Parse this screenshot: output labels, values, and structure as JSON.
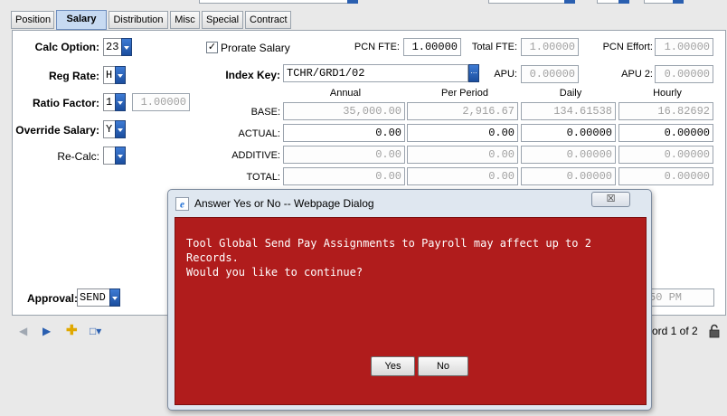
{
  "window": {
    "title": "Answer Yes or No -- Webpage Dialog"
  },
  "tabs": [
    "Position",
    "Salary",
    "Distribution",
    "Misc",
    "Special",
    "Contract"
  ],
  "form": {
    "calc_option": {
      "label": "Calc Option:",
      "value": "23"
    },
    "reg_rate": {
      "label": "Reg Rate:",
      "value": "H"
    },
    "ratio_factor": {
      "label": "Ratio Factor:",
      "value": "1",
      "amount": "1.00000"
    },
    "override_salary": {
      "label": "Override Salary:",
      "value": "Y"
    },
    "re_calc": {
      "label": "Re-Calc:",
      "value": ""
    },
    "prorate_salary": {
      "label": "Prorate Salary",
      "checked": "✓"
    },
    "index_key": {
      "label": "Index Key:",
      "value": "TCHR/GRD1/02",
      "lookup_label": "..."
    },
    "pcn_fte": {
      "label": "PCN FTE:",
      "value": "1.00000"
    },
    "total_fte": {
      "label": "Total FTE:",
      "value": "1.00000"
    },
    "pcn_effort": {
      "label": "PCN Effort:",
      "value": "1.00000"
    },
    "apu": {
      "label": "APU:",
      "value": "0.00000"
    },
    "apu2": {
      "label": "APU 2:",
      "value": "0.00000"
    },
    "approval": {
      "label": "Approval:",
      "value": "SEND"
    },
    "partial_time": "50 PM"
  },
  "salary_table": {
    "headers": [
      "Annual",
      "Per Period",
      "Daily",
      "Hourly"
    ],
    "rows": [
      {
        "label": "BASE:",
        "values": [
          "35,000.00",
          "2,916.67",
          "134.61538",
          "16.82692"
        ]
      },
      {
        "label": "ACTUAL:",
        "values": [
          "0.00",
          "0.00",
          "0.00000",
          "0.00000"
        ]
      },
      {
        "label": "ADDITIVE:",
        "values": [
          "0.00",
          "0.00",
          "0.00000",
          "0.00000"
        ]
      },
      {
        "label": "TOTAL:",
        "values": [
          "0.00",
          "0.00",
          "0.00000",
          "0.00000"
        ]
      }
    ]
  },
  "toolbar": {
    "record_text": "ord 1 of 2"
  },
  "dialog": {
    "message_line1": "Tool Global Send Pay Assignments to Payroll may affect up to 2 Records.",
    "message_line2": "Would you like to continue?",
    "yes_label": "Yes",
    "no_label": "No",
    "close_label": "☒"
  },
  "colors": {
    "dialog_body": "#b01c1c",
    "active_tab": "#c7daf2",
    "accent_button": "#2a5fb0"
  }
}
